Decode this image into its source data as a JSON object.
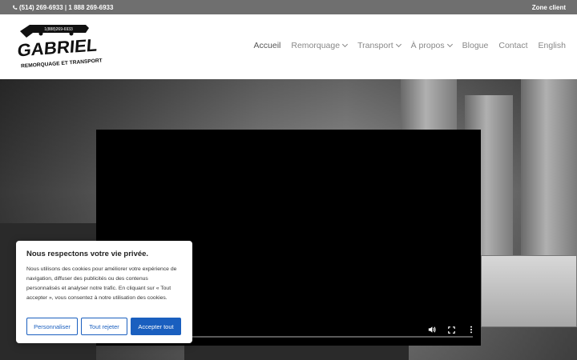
{
  "topbar": {
    "phone_text": "(514) 269-6933 | 1 888 269-6933",
    "client_zone": "Zone client"
  },
  "logo": {
    "name": "GABRIEL",
    "tagline": "REMORQUAGE ET TRANSPORT",
    "phone": "1(888)269-6933"
  },
  "nav": {
    "items": [
      {
        "label": "Accueil"
      },
      {
        "label": "Remorquage"
      },
      {
        "label": "Transport"
      },
      {
        "label": "À propos"
      },
      {
        "label": "Blogue"
      },
      {
        "label": "Contact"
      },
      {
        "label": "English"
      }
    ]
  },
  "cookie": {
    "title": "Nous respectons votre vie privée.",
    "text": "Nous utilisons des cookies pour améliorer votre expérience de navigation, diffuser des publicités ou des contenus personnalisés et analyser notre trafic. En cliquant sur « Tout accepter », vous consentez à notre utilisation des cookies.",
    "customize": "Personnaliser",
    "reject": "Tout rejeter",
    "accept": "Accepter tout"
  },
  "colors": {
    "topbar": "#6f6f6f",
    "accent": "#1a5fbf",
    "nav_text": "#888888"
  },
  "icons": {
    "phone": "phone-icon",
    "volume": "volume-icon",
    "fullscreen": "fullscreen-icon",
    "more": "more-vertical-icon"
  }
}
